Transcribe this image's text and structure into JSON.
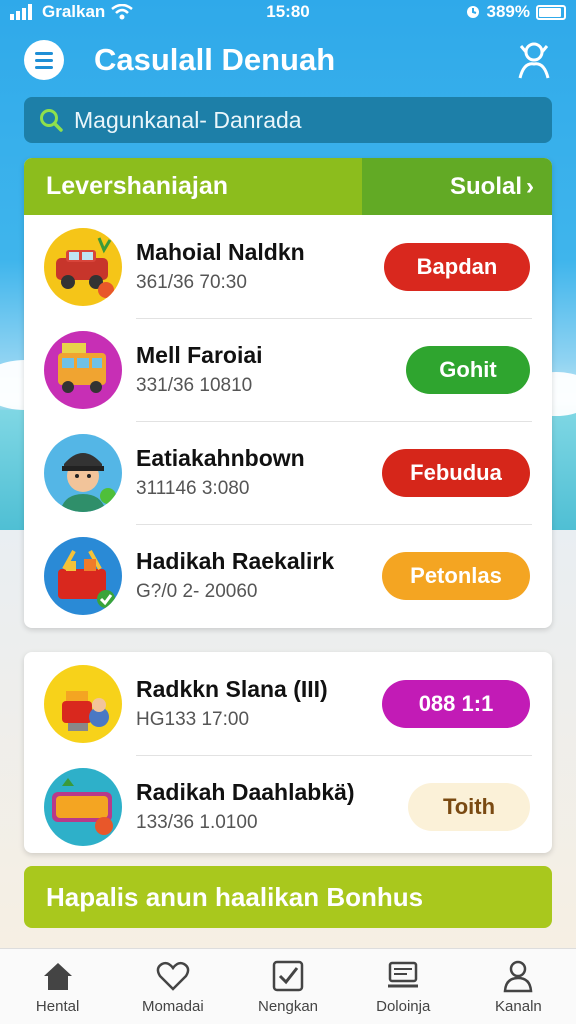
{
  "status": {
    "carrier": "Gralkan",
    "time": "15:80",
    "battery": "389%"
  },
  "header": {
    "title": "Casulall Denuah"
  },
  "search": {
    "text": "Magunkanal- Danrada"
  },
  "section": {
    "title": "Levershaniajan",
    "action": "Suolal"
  },
  "items": [
    {
      "name": "Mahoial Naldkn",
      "time": "361/36 70:30",
      "action": "Bapdan",
      "color": "#d9281e"
    },
    {
      "name": "Mell Faroiai",
      "time": "331/36 10810",
      "action": "Gohit",
      "color": "#2fa52f"
    },
    {
      "name": "Eatiakahnbown",
      "time": "311146 3:080",
      "action": "Febudua",
      "color": "#d6261a"
    },
    {
      "name": "Hadikah Raekalirk",
      "time": "G?/0 2- 20060",
      "action": "Petonlas",
      "color": "#f4a522"
    }
  ],
  "items2": [
    {
      "name": "Radkkn Slana (III)",
      "time": "HG133 17:00",
      "action": "088 1:1",
      "color": "#c21bb6"
    },
    {
      "name": "Radikah Daahlabkä)",
      "time": "133/36 1.0100",
      "action": "Toith",
      "color": "#fbf1d8",
      "text_color": "#7a4a12"
    }
  ],
  "bonus": {
    "text": "Hapalis anun haalikan Bonhus"
  },
  "tabs": [
    {
      "label": "Hental",
      "icon": "home-icon"
    },
    {
      "label": "Momadai",
      "icon": "heart-icon"
    },
    {
      "label": "Nengkan",
      "icon": "checkbox-icon"
    },
    {
      "label": "Doloinja",
      "icon": "monitor-icon"
    },
    {
      "label": "Kanaln",
      "icon": "user-icon"
    }
  ]
}
